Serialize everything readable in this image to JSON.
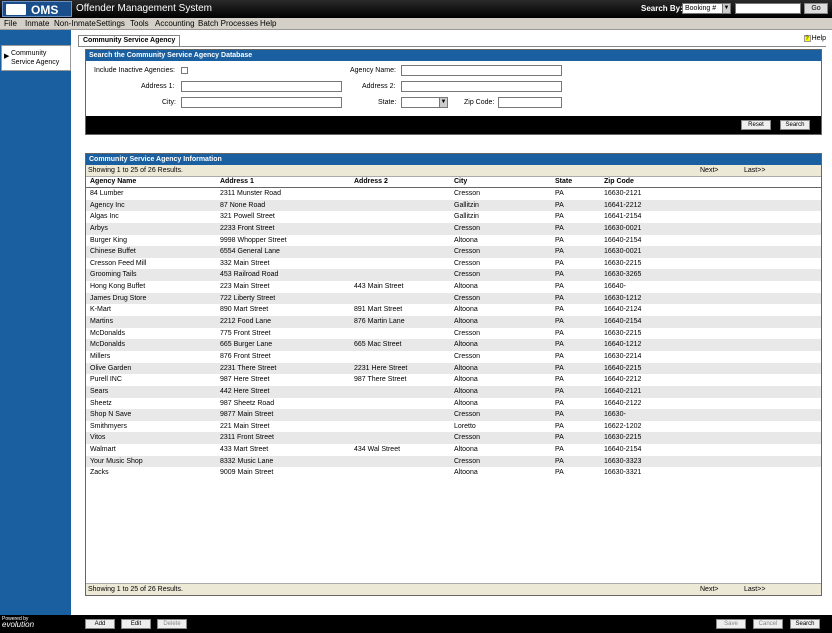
{
  "titlebar": {
    "logo": "OMS",
    "app_title": "Offender Management System",
    "searchby_label": "Search By:",
    "searchby_value": "Booking #",
    "go": "Go"
  },
  "menu": [
    "File",
    "Inmate",
    "Non-Inmate",
    "Settings",
    "Tools",
    "Accounting",
    "Batch Processes",
    "Help"
  ],
  "nav": {
    "item": "Community Service Agency"
  },
  "tab": {
    "label": "Community Service Agency",
    "help": "Help"
  },
  "search": {
    "header": "Search the Community Service Agency Database",
    "inactive_label": "Include Inactive Agencies:",
    "name_label": "Agency Name:",
    "address1_label": "Address 1:",
    "address2_label": "Address 2:",
    "city_label": "City:",
    "state_label": "State:",
    "zip_label": "Zip Code:",
    "reset": "Reset",
    "search": "Search"
  },
  "results": {
    "header": "Community Service Agency Information",
    "count": "Showing 1 to 25 of 26 Results.",
    "next": "Next>",
    "last": "Last>>",
    "columns": [
      "Agency Name",
      "Address 1",
      "Address 2",
      "City",
      "State",
      "Zip Code"
    ],
    "rows": [
      [
        "84 Lumber",
        "2311 Munster Road",
        "",
        "Cresson",
        "PA",
        "16630-2121"
      ],
      [
        "Agency Inc",
        "87 None Road",
        "",
        "Gallitzin",
        "PA",
        "16641-2212"
      ],
      [
        "Algas Inc",
        "321 Powell Street",
        "",
        "Gallitzin",
        "PA",
        "16641-2154"
      ],
      [
        "Arbys",
        "2233 Front Street",
        "",
        "Cresson",
        "PA",
        "16630-0021"
      ],
      [
        "Burger King",
        "9998 Whopper Street",
        "",
        "Altoona",
        "PA",
        "16640-2154"
      ],
      [
        "Chinese Buffet",
        "6554 General Lane",
        "",
        "Cresson",
        "PA",
        "16630-0021"
      ],
      [
        "Cresson Feed Mill",
        "332 Main Street",
        "",
        "Cresson",
        "PA",
        "16630-2215"
      ],
      [
        "Grooming Tails",
        "453 Railroad Road",
        "",
        "Cresson",
        "PA",
        "16630-3265"
      ],
      [
        "Hong Kong Buffet",
        "223 Main Street",
        "443 Main Street",
        "Altoona",
        "PA",
        "16640-"
      ],
      [
        "James Drug Store",
        "722 Liberty Street",
        "",
        "Cresson",
        "PA",
        "16630-1212"
      ],
      [
        "K-Mart",
        "890 Mart Street",
        "891 Mart Street",
        "Altoona",
        "PA",
        "16640-2124"
      ],
      [
        "Martins",
        "2212 Food Lane",
        "876 Martin Lane",
        "Altoona",
        "PA",
        "16640-2154"
      ],
      [
        "McDonalds",
        "775 Front Street",
        "",
        "Cresson",
        "PA",
        "16630-2215"
      ],
      [
        "McDonalds",
        "665 Burger Lane",
        "665 Mac Street",
        "Altoona",
        "PA",
        "16640-1212"
      ],
      [
        "Millers",
        "876 Front Street",
        "",
        "Cresson",
        "PA",
        "16630-2214"
      ],
      [
        "Olive Garden",
        "2231 There Street",
        "2231 Here Street",
        "Altoona",
        "PA",
        "16640-2215"
      ],
      [
        "Purell INC",
        "987 Here Street",
        "987 There Street",
        "Altoona",
        "PA",
        "16640-2212"
      ],
      [
        "Sears",
        "442 Here Street",
        "",
        "Altoona",
        "PA",
        "16640-2121"
      ],
      [
        "Sheetz",
        "987 Sheetz Road",
        "",
        "Altoona",
        "PA",
        "16640-2122"
      ],
      [
        "Shop N Save",
        "9877 Main Street",
        "",
        "Cresson",
        "PA",
        "16630-"
      ],
      [
        "Smithmyers",
        "221 Main Street",
        "",
        "Loretto",
        "PA",
        "16622-1202"
      ],
      [
        "Vitos",
        "2311 Front Street",
        "",
        "Cresson",
        "PA",
        "16630-2215"
      ],
      [
        "Walmart",
        "433 Mart Street",
        "434 Wal Street",
        "Altoona",
        "PA",
        "16640-2154"
      ],
      [
        "Your Music Shop",
        "8332 Music Lane",
        "",
        "Cresson",
        "PA",
        "16630-3323"
      ],
      [
        "Zacks",
        "9009 Main Street",
        "",
        "Altoona",
        "PA",
        "16630-3321"
      ]
    ]
  },
  "bottom": {
    "powered": "Powered by",
    "brand": "evolution",
    "add": "Add",
    "edit": "Edit",
    "delete": "Delete",
    "save": "Save",
    "cancel": "Cancel",
    "search": "Search"
  }
}
